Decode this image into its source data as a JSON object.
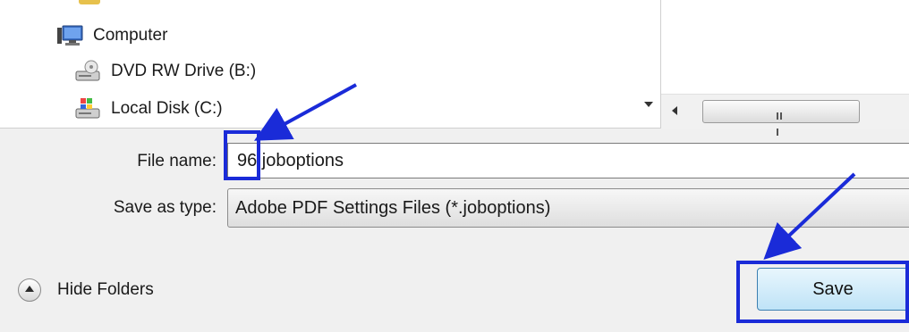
{
  "tree": {
    "items": [
      {
        "label": "Computer",
        "icon": "computer-icon"
      },
      {
        "label": "DVD RW Drive (B:)",
        "icon": "dvd-drive-icon"
      },
      {
        "label": "Local Disk (C:)",
        "icon": "local-disk-icon"
      }
    ]
  },
  "form": {
    "file_name_label": "File name:",
    "file_name_value": "96.joboptions",
    "save_type_label": "Save as type:",
    "save_type_value": "Adobe PDF Settings Files (*.joboptions)"
  },
  "footer": {
    "hide_folders_label": "Hide Folders",
    "save_label": "Save"
  },
  "annotations": {
    "highlight_color": "#1a2bd8"
  }
}
